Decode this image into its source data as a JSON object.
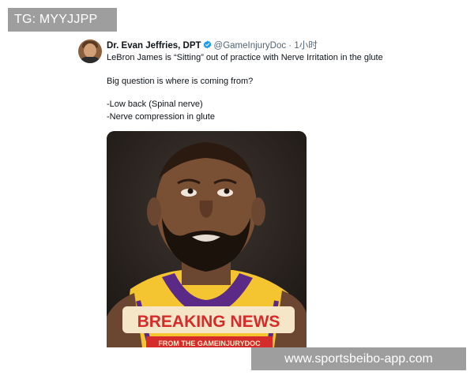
{
  "watermark_top": "TG: MYYJJPP",
  "watermark_bottom": "www.sportsbeibo-app.com",
  "tweet": {
    "author_name": "Dr. Evan Jeffries, DPT",
    "handle": "@GameInjuryDoc",
    "separator": "·",
    "time": "1小时",
    "lines": [
      "LeBron James is “Sitting” out of practice with Nerve Irritation in the glute",
      "Big question is where is coming from?",
      "-Low back (Spinal nerve)",
      "-Nerve compression in glute"
    ],
    "media": {
      "headline": "BREAKING NEWS",
      "subline": "FROM THE GAMEINJURYDOC"
    }
  },
  "colors": {
    "verified_badge": "#1d9bf0",
    "headline_text": "#d62b2b",
    "headline_bg": "#f5e6c8",
    "jersey": "#f4c431"
  }
}
